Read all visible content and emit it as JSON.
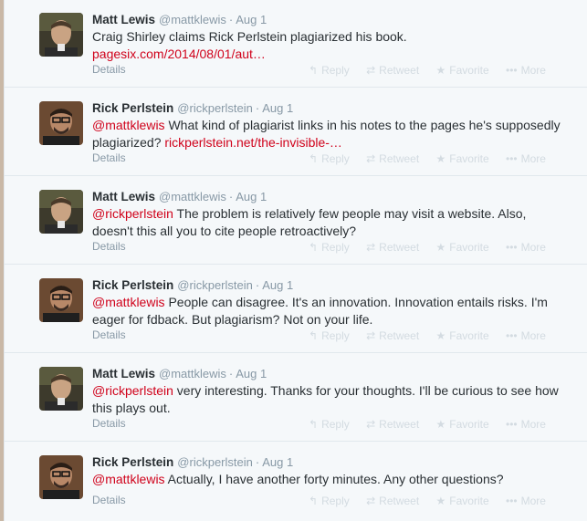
{
  "tweets": [
    {
      "fullname": "Matt Lewis",
      "username": "@mattklewis",
      "separator": "·",
      "time": "Aug 1",
      "mention": "",
      "text": "Craig Shirley claims Rick Perlstein plagiarized his book. ",
      "link": "pagesix.com/2014/08/01/aut…",
      "details": "Details",
      "avatar": "matt",
      "actions": {
        "reply": "Reply",
        "retweet": "Retweet",
        "favorite": "Favorite",
        "more": "More"
      }
    },
    {
      "fullname": "Rick Perlstein",
      "username": "@rickperlstein",
      "separator": "·",
      "time": "Aug 1",
      "mention": "@mattklewis",
      "text": " What kind of plagiarist links in his notes to the pages he's supposedly plagiarized? ",
      "link": "rickperlstein.net/the-invisible-…",
      "details": "Details",
      "avatar": "rick",
      "actions": {
        "reply": "Reply",
        "retweet": "Retweet",
        "favorite": "Favorite",
        "more": "More"
      }
    },
    {
      "fullname": "Matt Lewis",
      "username": "@mattklewis",
      "separator": "·",
      "time": "Aug 1",
      "mention": "@rickperlstein",
      "text": " The problem is relatively few people may visit a website. Also, doesn't this all you to cite people retroactively?",
      "link": "",
      "details": "Details",
      "avatar": "matt",
      "actions": {
        "reply": "Reply",
        "retweet": "Retweet",
        "favorite": "Favorite",
        "more": "More"
      }
    },
    {
      "fullname": "Rick Perlstein",
      "username": "@rickperlstein",
      "separator": "·",
      "time": "Aug 1",
      "mention": "@mattklewis",
      "text": " People can disagree. It's an innovation. Innovation entails risks. I'm eager for fdback. But plagiarism? Not on your life.",
      "link": "",
      "details": "Details",
      "avatar": "rick",
      "actions": {
        "reply": "Reply",
        "retweet": "Retweet",
        "favorite": "Favorite",
        "more": "More"
      }
    },
    {
      "fullname": "Matt Lewis",
      "username": "@mattklewis",
      "separator": "·",
      "time": "Aug 1",
      "mention": "@rickperlstein",
      "text": " very interesting. Thanks for your thoughts. I'll be curious to see how this plays out.",
      "link": "",
      "details": "Details",
      "avatar": "matt",
      "actions": {
        "reply": "Reply",
        "retweet": "Retweet",
        "favorite": "Favorite",
        "more": "More"
      }
    },
    {
      "fullname": "Rick Perlstein",
      "username": "@rickperlstein",
      "separator": "·",
      "time": "Aug 1",
      "mention": "@mattklewis",
      "text": " Actually, I have another forty minutes. Any other questions?",
      "link": "",
      "details": "Details",
      "avatar": "rick",
      "actions": {
        "reply": "Reply",
        "retweet": "Retweet",
        "favorite": "Favorite",
        "more": "More"
      }
    }
  ],
  "icons": {
    "reply": "reply-icon",
    "retweet": "retweet-icon",
    "favorite": "star-icon",
    "more": "more-icon"
  },
  "colors": {
    "link": "#d0021b",
    "muted": "#8899a6",
    "text": "#292f33",
    "actions": "#d3dbe1",
    "background": "#f5f8fa"
  }
}
